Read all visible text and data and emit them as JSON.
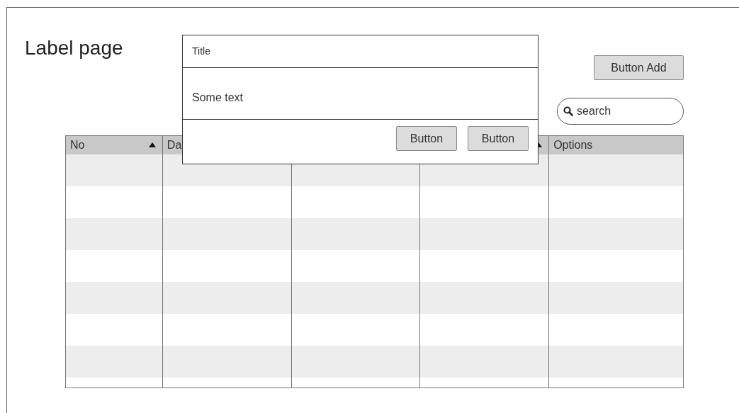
{
  "page": {
    "title": "Label page"
  },
  "add_button": "Button Add",
  "search": {
    "placeholder": "search"
  },
  "table": {
    "columns": [
      {
        "label": "No",
        "sorted": true
      },
      {
        "label": "Da"
      },
      null,
      {
        "sorted": true
      },
      {
        "label": "Options",
        "sorted": false
      }
    ]
  },
  "dialog": {
    "title": "Title",
    "text": "Some text",
    "buttons": [
      "Button",
      "Button"
    ]
  }
}
